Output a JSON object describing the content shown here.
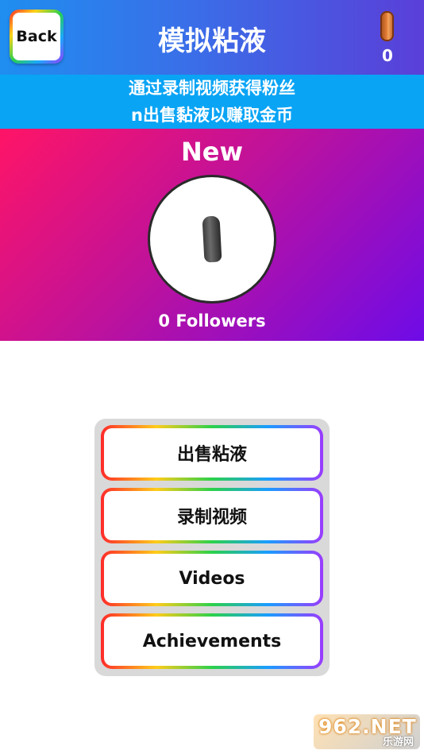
{
  "header": {
    "back_label": "Back",
    "title": "模拟粘液",
    "coin_count": "0"
  },
  "banner": {
    "line1": "通过录制视频获得粉丝",
    "line2": "n出售黏液以赚取金币"
  },
  "profile": {
    "name": "New",
    "followers": "0 Followers"
  },
  "menu": {
    "items": [
      {
        "label": "出售粘液"
      },
      {
        "label": "录制视频"
      },
      {
        "label": "Videos"
      },
      {
        "label": "Achievements"
      }
    ]
  },
  "watermark": {
    "main": "962.NET",
    "sub": "乐游网"
  },
  "colors": {
    "header_gradient": [
      "#1f8ef0",
      "#5a3fd8"
    ],
    "banner": "#0aa4f5",
    "profile_gradient": [
      "#ff1466",
      "#6e0be8"
    ],
    "panel": "#d9d9d9"
  },
  "icons": {
    "coin": "coin-icon",
    "slime": "slime-icon"
  }
}
